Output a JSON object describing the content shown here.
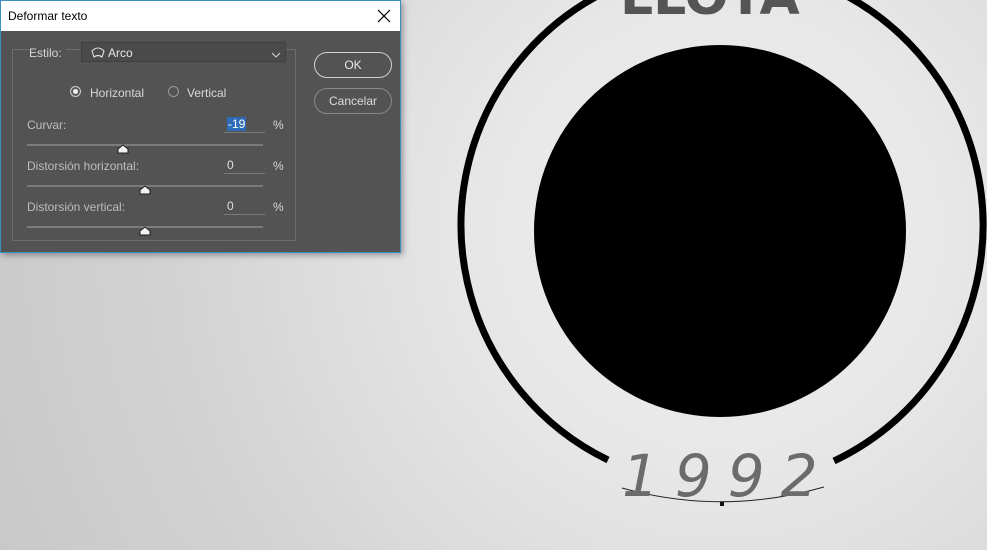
{
  "dialog": {
    "title": "Deformar texto",
    "style_label": "Estilo:",
    "style_value": "Arco",
    "orientation": {
      "horizontal_label": "Horizontal",
      "vertical_label": "Vertical",
      "selected": "Horizontal"
    },
    "bend": {
      "label": "Curvar:",
      "value": "-19",
      "unit": "%",
      "level": -19
    },
    "horizontal_distortion": {
      "label": "Distorsión horizontal:",
      "value": "0",
      "unit": "%",
      "level": 0
    },
    "vertical_distortion": {
      "label": "Distorsión vertical:",
      "value": "0",
      "unit": "%",
      "level": 0
    },
    "ok_label": "OK",
    "cancel_label": "Cancelar"
  },
  "artwork": {
    "year_text": "1992",
    "top_text": "LLOYA"
  },
  "colors": {
    "dialog_bg": "#535353",
    "accent": "#2e6cb8",
    "canvas_bg": "#e2e2e2",
    "ink": "#000000"
  },
  "icons": [
    "close-icon",
    "warp-arc-icon",
    "chevron-down-icon",
    "slider-thumb-icon"
  ]
}
